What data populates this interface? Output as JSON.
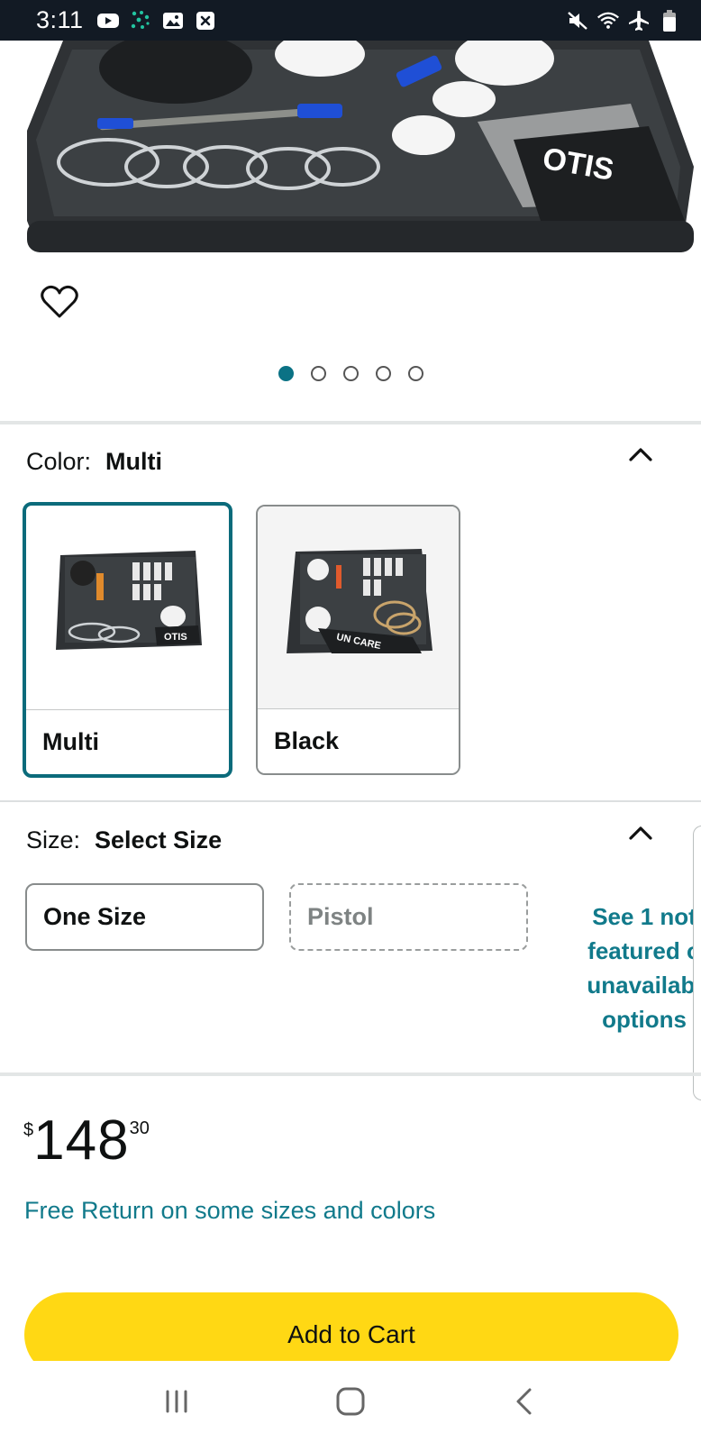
{
  "status_bar": {
    "time": "3:11",
    "left_icons": [
      "youtube-icon",
      "dots-icon",
      "image-icon",
      "close-box-icon"
    ],
    "right_icons": [
      "mute-icon",
      "wifi-icon",
      "airplane-icon",
      "battery-icon"
    ]
  },
  "product": {
    "image_dots_count": 5,
    "active_dot": 0
  },
  "color": {
    "label": "Color:",
    "selected": "Multi",
    "options": [
      {
        "label": "Multi"
      },
      {
        "label": "Black"
      }
    ]
  },
  "size": {
    "label": "Size:",
    "selected": "Select Size",
    "options": [
      {
        "label": "One Size",
        "available": true
      },
      {
        "label": "Pistol",
        "available": false
      }
    ],
    "see_more": "See 1 not\nfeatured o\nunavailabl\noptions"
  },
  "price": {
    "symbol": "$",
    "whole": "148",
    "fraction": "30"
  },
  "free_return": "Free Return on some sizes and colors",
  "add_to_cart": "Add to Cart",
  "colors": {
    "accent": "#117a8b",
    "selected_border": "#0b6b7b",
    "cart_button": "#ffd814",
    "status_bar": "#121a24"
  }
}
